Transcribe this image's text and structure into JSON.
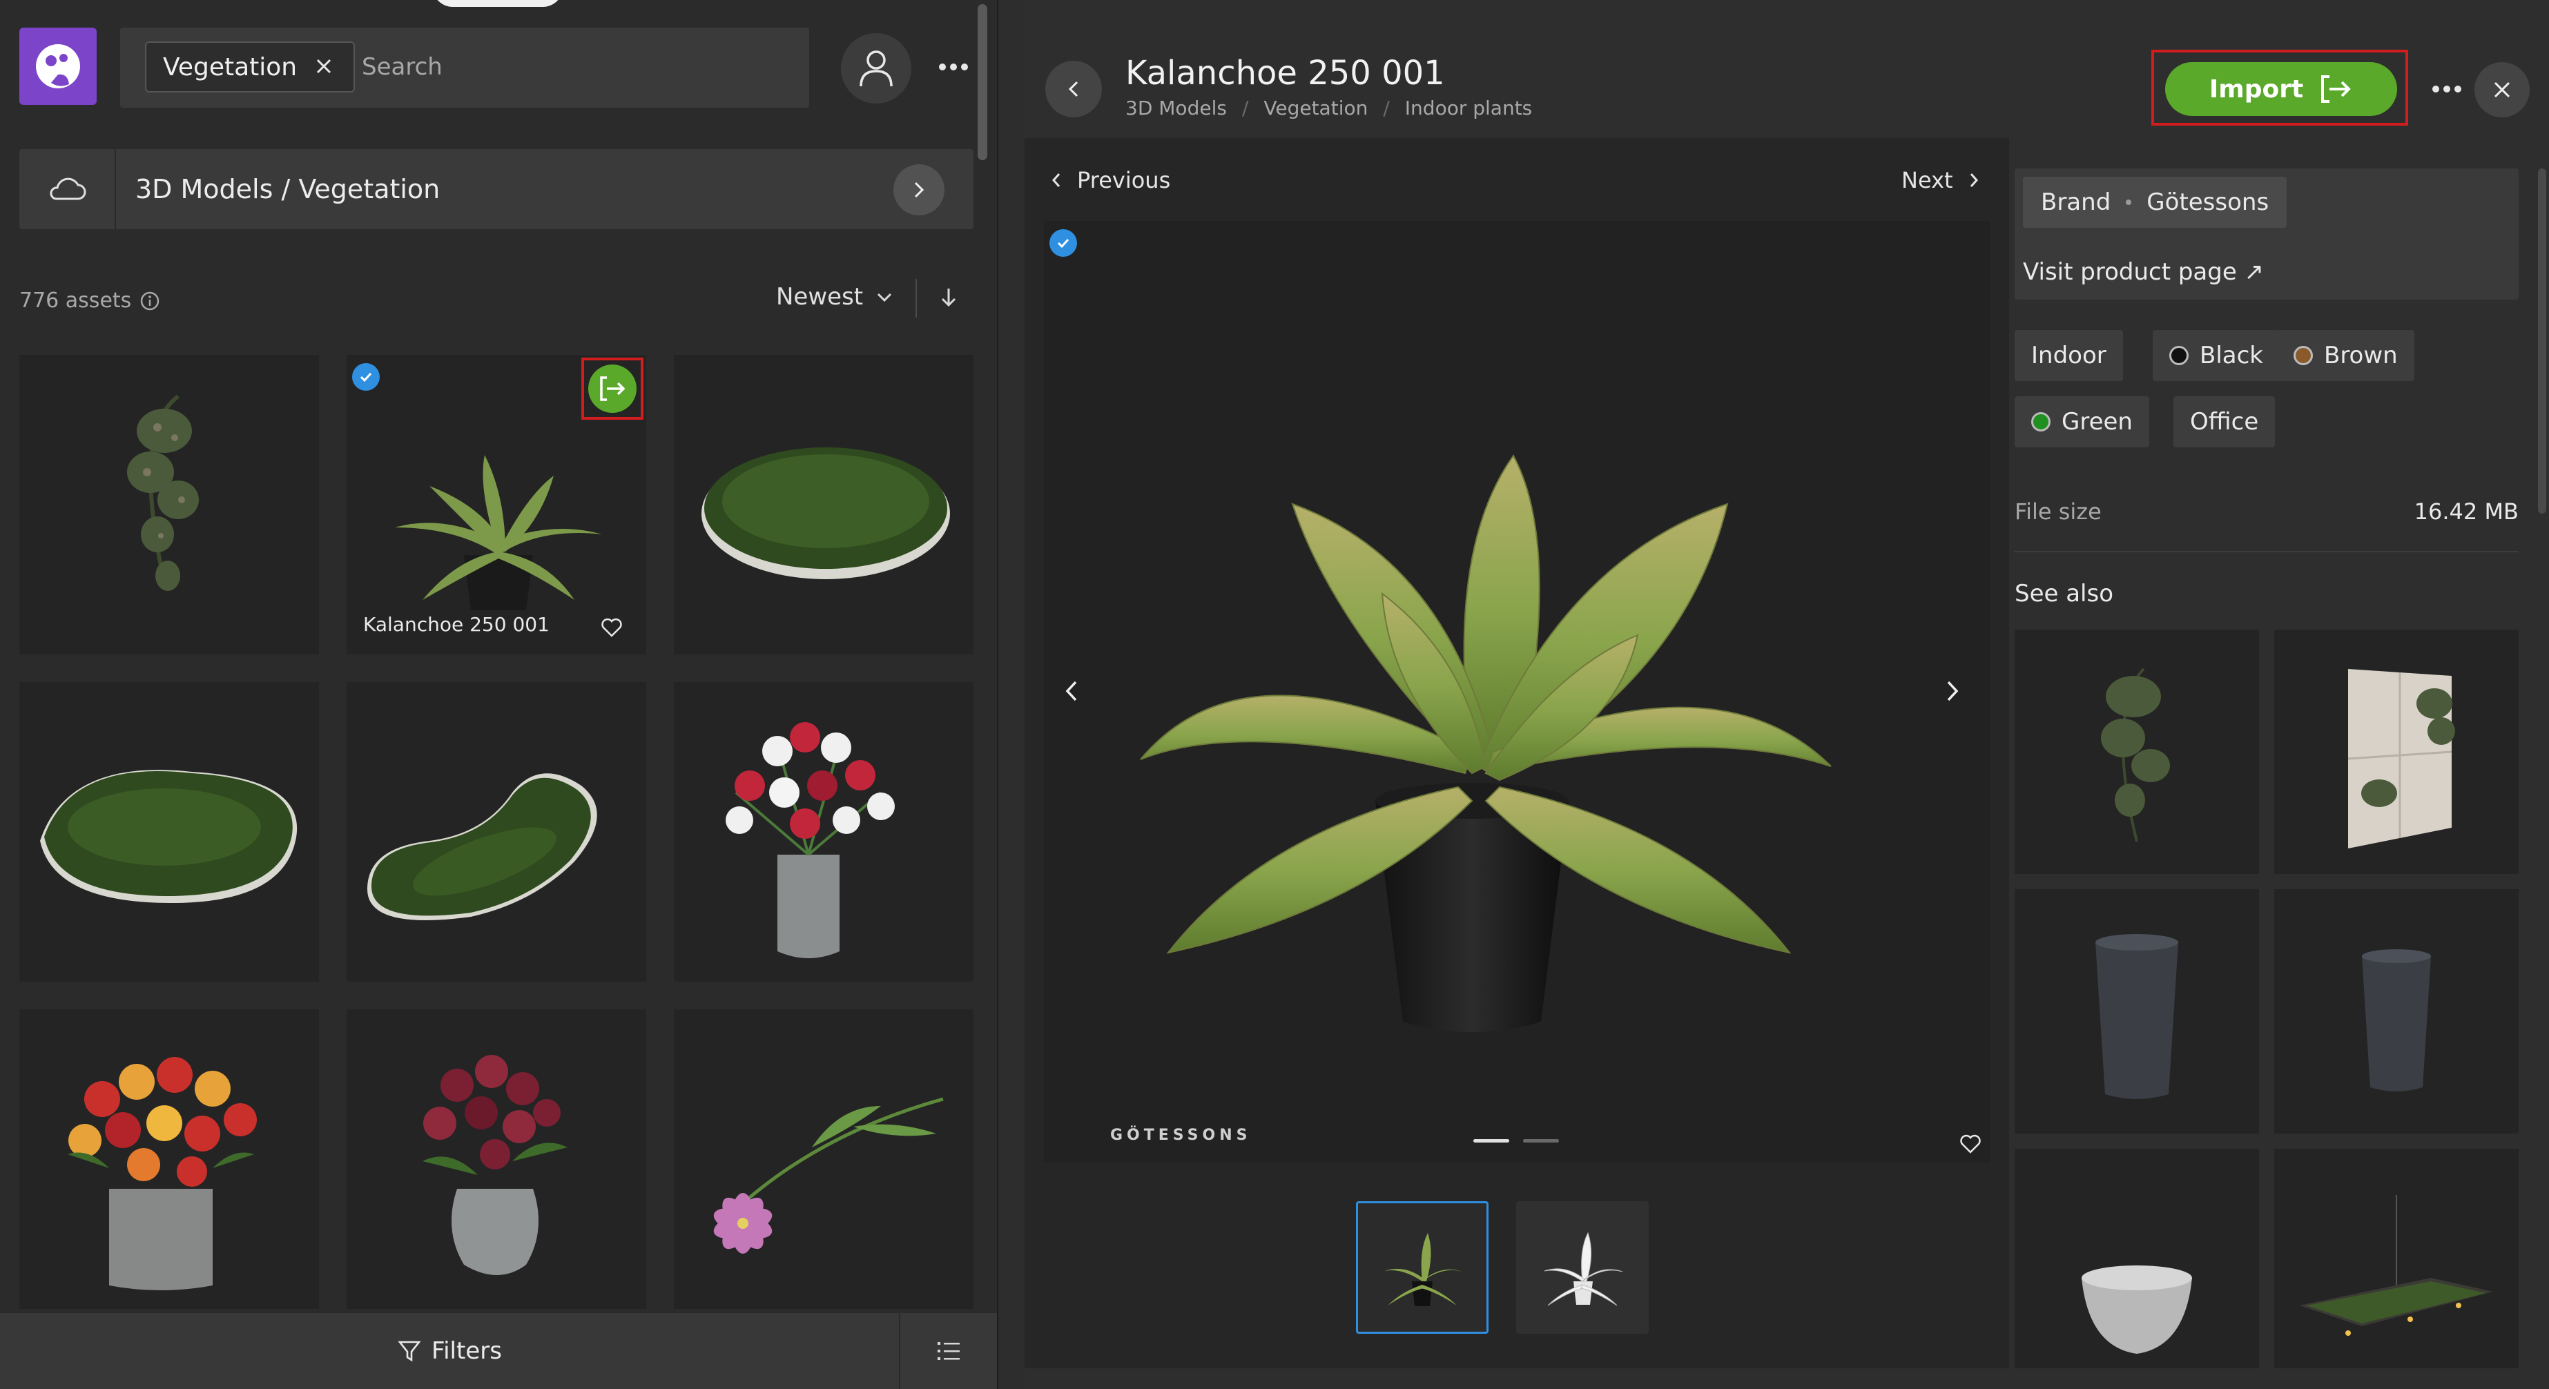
{
  "colors": {
    "accent_green": "#5aa92a",
    "highlight_red": "#d11d1d",
    "check_blue": "#2f8fe0",
    "logo_purple": "#7b44c9"
  },
  "sidebar": {
    "logo_icon": "app-logo-icon",
    "search": {
      "filter_chip": "Vegetation",
      "placeholder": "Search",
      "value": ""
    },
    "path": "3D Models / Vegetation",
    "asset_count": "776 assets",
    "sort": "Newest",
    "grid": [
      {
        "label": "",
        "kind": "hanging-plant"
      },
      {
        "label": "Kalanchoe 250 001",
        "kind": "kalanchoe",
        "selected": true,
        "hovered": true
      },
      {
        "label": "",
        "kind": "moss-oval"
      },
      {
        "label": "",
        "kind": "moss-blob"
      },
      {
        "label": "",
        "kind": "moss-kidney"
      },
      {
        "label": "",
        "kind": "tulips-vase"
      },
      {
        "label": "",
        "kind": "tulips-mixed"
      },
      {
        "label": "",
        "kind": "tulips-dark"
      },
      {
        "label": "",
        "kind": "lily-stem"
      }
    ],
    "bottom": {
      "filters_label": "Filters"
    }
  },
  "detail": {
    "title": "Kalanchoe 250 001",
    "breadcrumbs": [
      "3D Models",
      "Vegetation",
      "Indoor plants"
    ],
    "import_label": "Import",
    "previous_label": "Previous",
    "next_label": "Next",
    "watermark": "GÖTESSONS",
    "slide_count": 2,
    "active_slide": 0,
    "brand_label": "Brand",
    "brand_value": "Götessons",
    "visit_label": "Visit product page ↗",
    "tags": [
      {
        "label": "Indoor",
        "swatch": null
      },
      {
        "label": "Black",
        "swatch": "#111111"
      },
      {
        "label": "Brown",
        "swatch": "#8a5a2b"
      },
      {
        "label": "Green",
        "swatch": "#1f8f1f"
      },
      {
        "label": "Office",
        "swatch": null
      }
    ],
    "file_size_label": "File size",
    "file_size_value": "16.42 MB",
    "see_also_label": "See also",
    "related": [
      "hanging-plant",
      "wall-panel-plant",
      "planter-tall",
      "planter-tall-2",
      "bowl-planter",
      "ceiling-garden"
    ]
  }
}
